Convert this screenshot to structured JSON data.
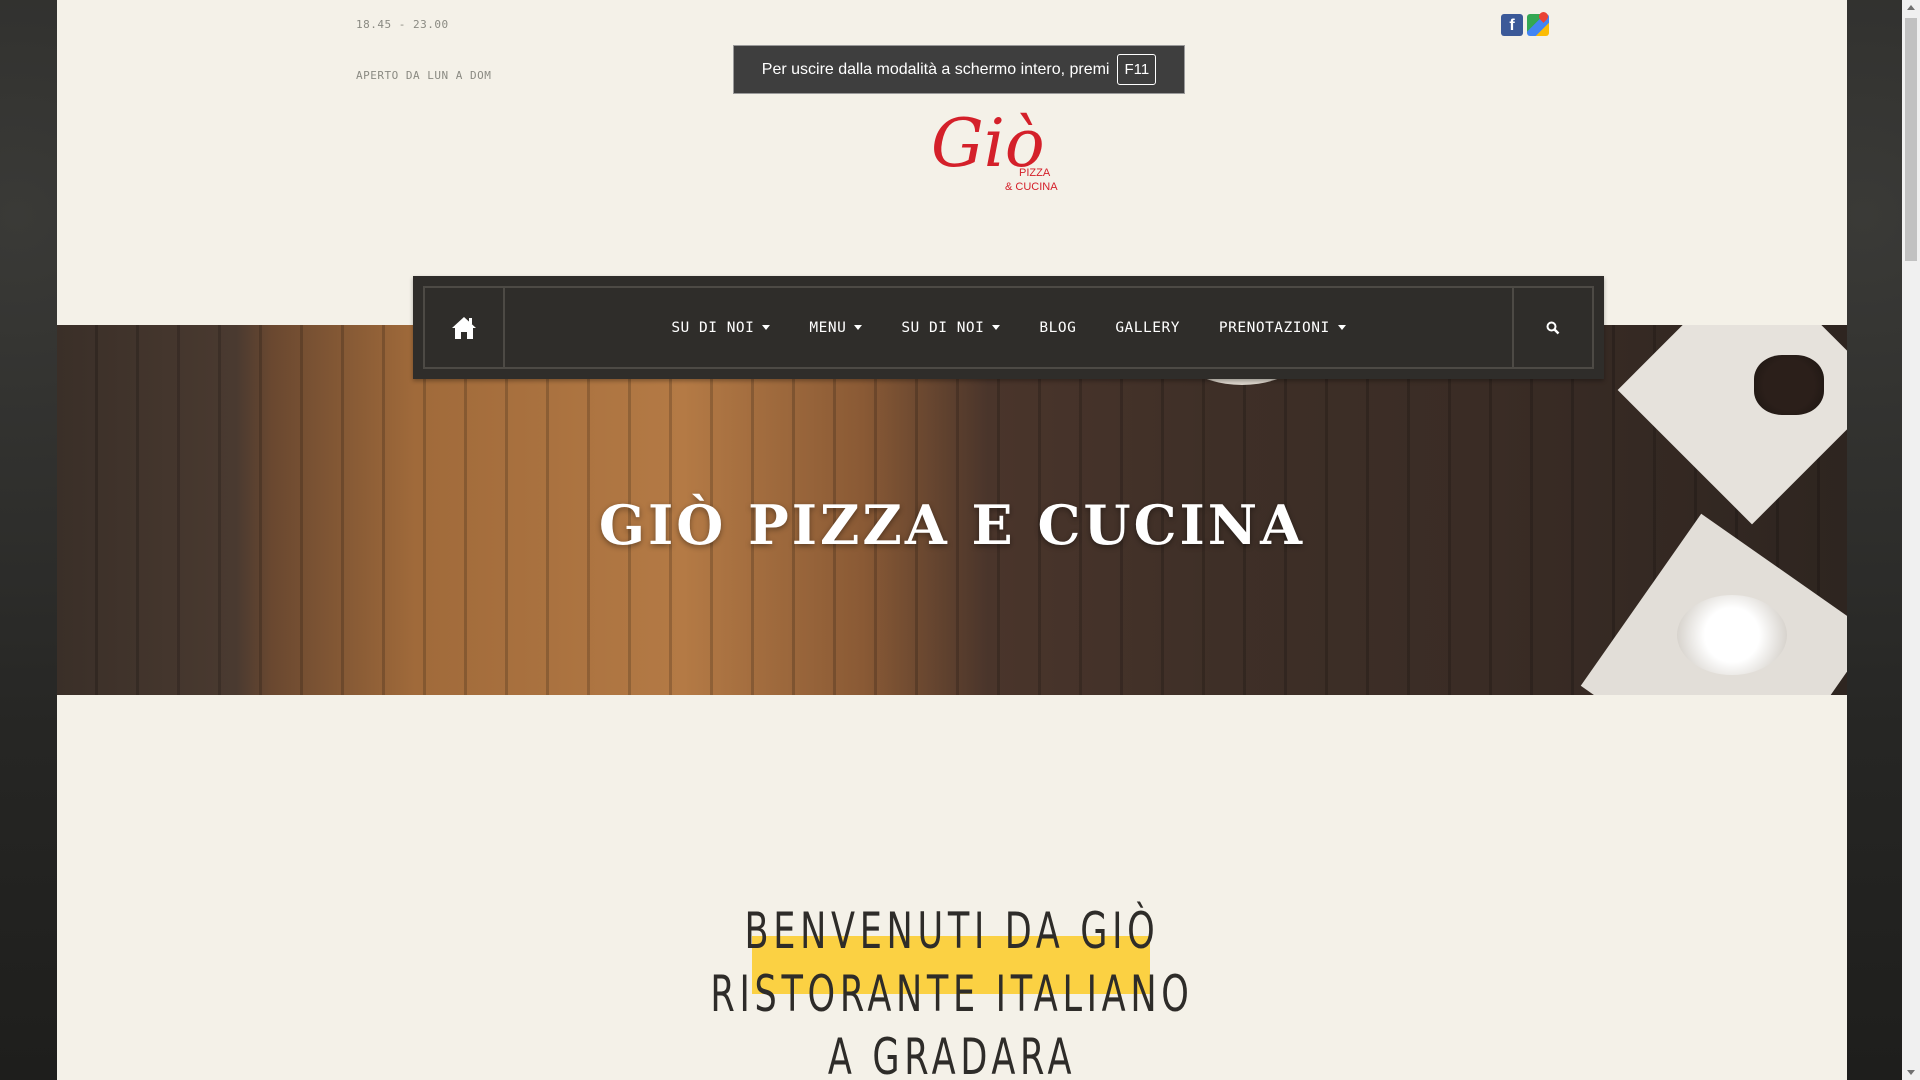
{
  "top_bar": {
    "hours": "18.45 - 23.00",
    "open_days": "APERTO DA LUN A DOM"
  },
  "fullscreen_notice": {
    "text": "Per uscire dalla modalità a schermo intero, premi",
    "key": "F11"
  },
  "logo": {
    "script": "Giò",
    "line1": "PIZZA",
    "line2": "& CUCINA",
    "color": "#d4202a"
  },
  "nav": {
    "items": [
      {
        "label": "SU DI NOI",
        "dropdown": true
      },
      {
        "label": "MENU",
        "dropdown": true
      },
      {
        "label": "SU DI NOI",
        "dropdown": true
      },
      {
        "label": "BLOG",
        "dropdown": false
      },
      {
        "label": "GALLERY",
        "dropdown": false
      },
      {
        "label": "PRENOTAZIONI",
        "dropdown": true
      }
    ],
    "home_icon": "home-icon",
    "search_icon": "search-icon"
  },
  "hero": {
    "title": "GIÒ PIZZA E CUCINA"
  },
  "welcome": {
    "line1": "BENVENUTI DA GIÒ",
    "line2": "RISTORANTE ITALIANO",
    "line3": "A GRADARA",
    "highlight_color": "#fbd143"
  },
  "social": [
    {
      "icon": "facebook-icon"
    },
    {
      "icon": "google-maps-icon"
    }
  ]
}
